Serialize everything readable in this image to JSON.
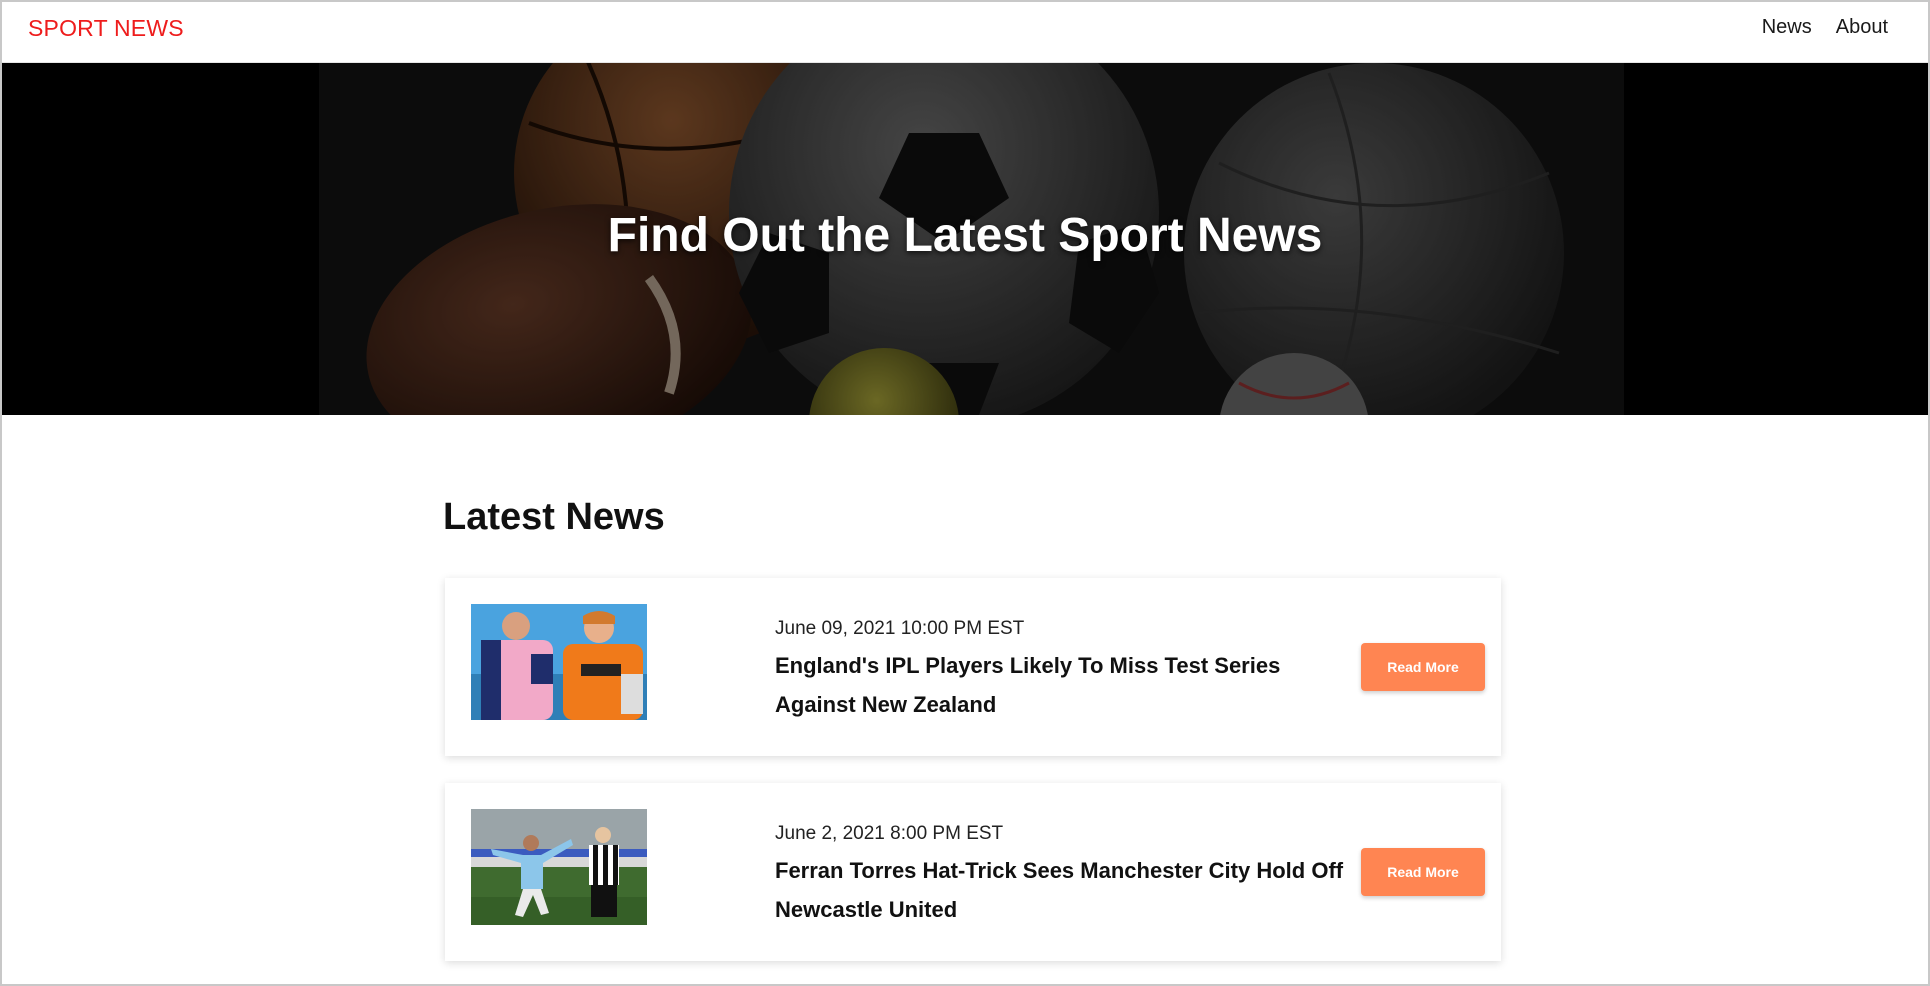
{
  "navbar": {
    "brand": "SPORT NEWS",
    "links": [
      {
        "label": "News"
      },
      {
        "label": "About"
      }
    ]
  },
  "hero": {
    "title": "Find Out the Latest Sport News"
  },
  "latest": {
    "heading": "Latest News",
    "articles": [
      {
        "date": "June 09, 2021 10:00 PM EST",
        "title": "England's IPL Players Likely To Miss Test Series Against New Zealand",
        "button": "Read More"
      },
      {
        "date": "June 2, 2021 8:00 PM EST",
        "title": "Ferran Torres Hat-Trick Sees Manchester City Hold Off Newcastle United",
        "button": "Read More"
      }
    ]
  },
  "colors": {
    "brand": "#ee1c1c",
    "button": "#ff8552"
  }
}
